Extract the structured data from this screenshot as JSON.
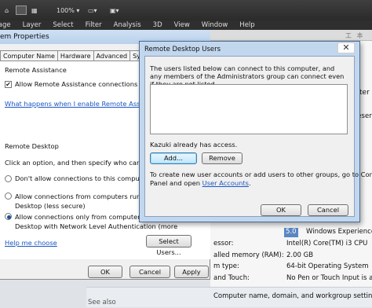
{
  "appbar": {
    "zoom": "100%",
    "menu": [
      "Image",
      "Layer",
      "Select",
      "Filter",
      "Analysis",
      "3D",
      "View",
      "Window",
      "Help"
    ]
  },
  "background": {
    "cjk": "工 本 ≡",
    "rows": [
      {
        "label": "",
        "value": "reserve"
      },
      {
        "label": "",
        "value": "ter"
      },
      {
        "label": "",
        "value": "5.0"
      },
      {
        "label": "",
        "value": "Windows Experience Ir"
      },
      {
        "label": "essor:",
        "value": "Intel(R) Core(TM) i3 CPU"
      },
      {
        "label": "alled memory (RAM):",
        "value": "2.00 GB"
      },
      {
        "label": "m type:",
        "value": "64-bit Operating System"
      },
      {
        "label": "and Touch:",
        "value": "No Pen or Touch Input is availa"
      }
    ],
    "computer_settings": "Computer name, domain, and workgroup settings",
    "see_also": "See also"
  },
  "sysprops": {
    "title": "em Properties",
    "tabs": [
      "Computer Name",
      "Hardware",
      "Advanced",
      "System Prote"
    ],
    "remote_assistance": {
      "header": "Remote Assistance",
      "checkbox_label": "Allow Remote Assistance connections to this comput",
      "link": "What happens when I enable Remote Assistance?"
    },
    "remote_desktop": {
      "header": "Remote Desktop",
      "instruction": "Click an option, and then specify who can connect, if n",
      "option1": "Don't allow connections to this computer",
      "option2_line1": "Allow connections from computers running any ve",
      "option2_line2": "Desktop (less secure)",
      "option3_line1": "Allow connections only from computers running R",
      "option3_line2": "Desktop with Network Level Authentication (more",
      "help_link": "Help me choose",
      "select_users": "Select Users..."
    },
    "buttons": {
      "ok": "OK",
      "cancel": "Cancel",
      "apply": "Apply"
    }
  },
  "rdu": {
    "title": "Remote Desktop Users",
    "description": "The users listed below can connect to this computer, and any members of the Administrators group can connect even if they are not listed.",
    "users": [],
    "access_note": "Kazuki already has access.",
    "add": "Add...",
    "remove": "Remove",
    "create_text_1": "To create new user accounts or add users to other groups, go to Control",
    "create_text_2": "Panel and open",
    "user_accounts_link": "User Accounts",
    "create_text_3": ".",
    "ok": "OK",
    "cancel": "Cancel",
    "close": "✕"
  }
}
